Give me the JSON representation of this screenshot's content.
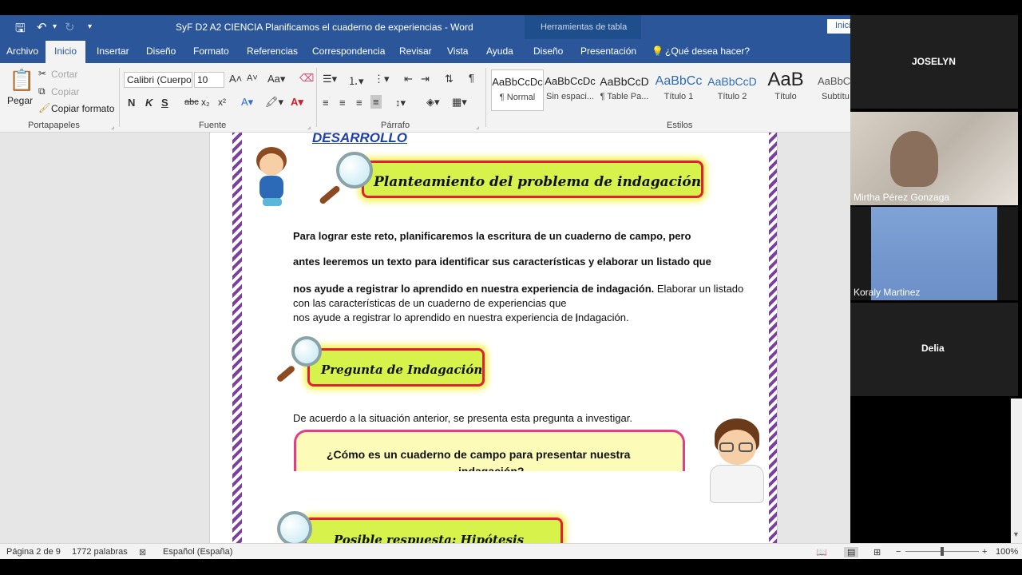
{
  "window": {
    "title": "SyF D2 A2 CIENCIA Planificamos el cuaderno de experiencias  -  Word",
    "table_tools": "Herramientas de tabla",
    "signin": "Inicia"
  },
  "tabs": [
    "Archivo",
    "Inicio",
    "Insertar",
    "Diseño",
    "Formato",
    "Referencias",
    "Correspondencia",
    "Revisar",
    "Vista",
    "Ayuda",
    "Diseño",
    "Presentación"
  ],
  "tell_me": "¿Qué desea hacer?",
  "clipboard": {
    "paste": "Pegar",
    "cut": "Cortar",
    "copy": "Copiar",
    "format_painter": "Copiar formato",
    "label": "Portapapeles"
  },
  "font": {
    "name": "Calibri (Cuerpo",
    "size": "10",
    "label": "Fuente",
    "bold": "N",
    "italic": "K",
    "underline": "S",
    "strike": "abc",
    "sub": "x₂",
    "sup": "x²"
  },
  "paragraph": {
    "label": "Párrafo"
  },
  "styles": {
    "label": "Estilos",
    "items": [
      {
        "preview": "AaBbCcDc",
        "name": "¶ Normal"
      },
      {
        "preview": "AaBbCcDc",
        "name": "Sin espaci..."
      },
      {
        "preview": "AaBbCcD",
        "name": "¶ Table Pa..."
      },
      {
        "preview": "AaBbCc",
        "name": "Título 1"
      },
      {
        "preview": "AaBbCcD",
        "name": "Título 2"
      },
      {
        "preview": "AaB",
        "name": "Título"
      },
      {
        "preview": "AaBbCc",
        "name": "Subtítu"
      }
    ]
  },
  "document": {
    "heading": "DESARROLLO",
    "banner1": "Planteamiento del problema de indagación:",
    "para_line1": "Para lograr este reto, planificaremos la escritura de un cuaderno de campo, pero",
    "para_line2": "antes leeremos un texto para identificar sus características y elaborar un listado que",
    "para_line3_bold": "nos ayude a registrar lo aprendido en nuestra experiencia de indagación.",
    "para_line3_rest": " Elaborar un listado",
    "para_line4": "con las características de un cuaderno de experiencias que",
    "para_line5": "nos ayude a registrar lo aprendido en nuestra experiencia de indagación.",
    "banner2": "Pregunta de Indagación:",
    "situation": "De acuerdo a la situación anterior, se presenta esta pregunta a investigar.",
    "question_line1": "¿Cómo es un cuaderno de campo para presentar nuestra",
    "question_line2": "indagación?",
    "banner3": "Posible respuesta: Hipótesis"
  },
  "status": {
    "page": "Página 2 de 9",
    "words": "1772 palabras",
    "language": "Español (España)",
    "zoom": "100%"
  },
  "participants": [
    {
      "name": "JOSELYN"
    },
    {
      "name": "Mirtha Pérez Gonzaga"
    },
    {
      "name": "Koraly  Martinez"
    },
    {
      "name": "Delia"
    }
  ],
  "colors": {
    "word_blue": "#2b579a",
    "banner_fill": "#d7f24a",
    "banner_border": "#e0203a",
    "heading": "#1f3fae"
  }
}
